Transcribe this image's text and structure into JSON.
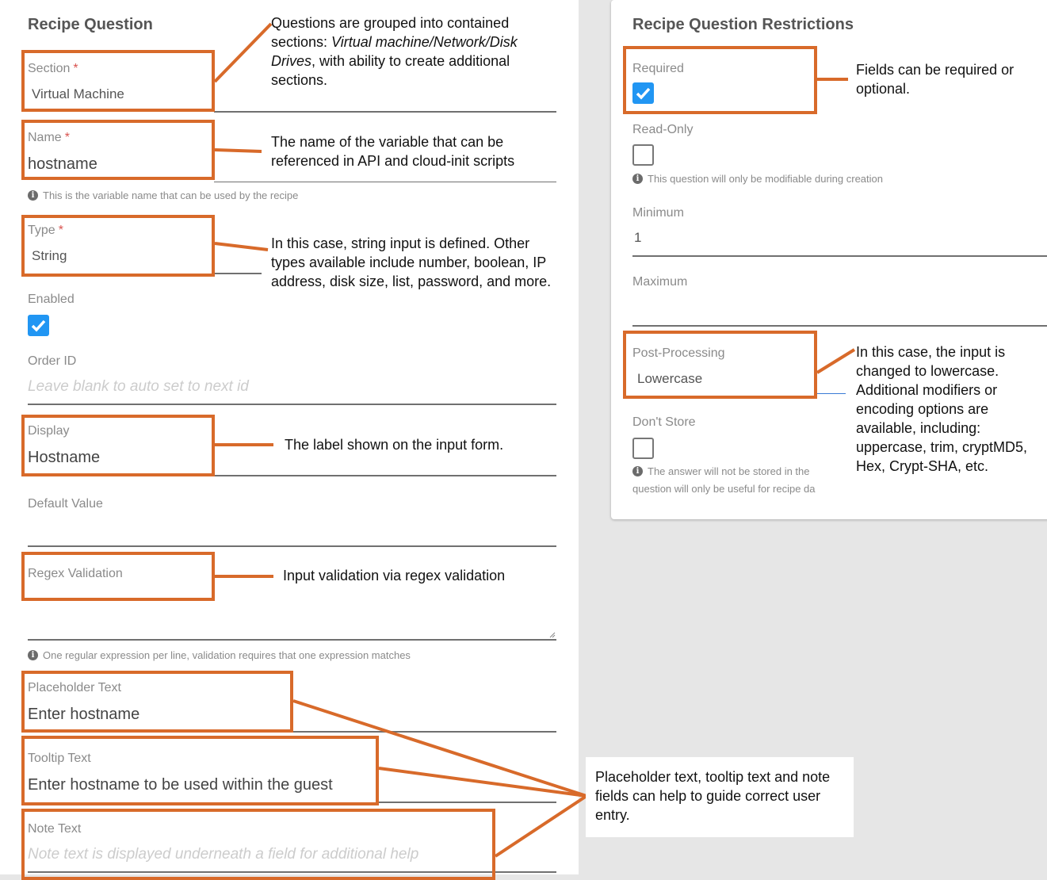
{
  "left": {
    "heading": "Recipe Question",
    "section": {
      "label": "Section",
      "required": "*",
      "value": "Virtual Machine"
    },
    "name": {
      "label": "Name",
      "required": "*",
      "value": "hostname",
      "hint": "This is the variable name that can be used by the recipe"
    },
    "type": {
      "label": "Type",
      "required": "*",
      "value": "String"
    },
    "enabled": {
      "label": "Enabled",
      "checked": true
    },
    "order_id": {
      "label": "Order ID",
      "placeholder": "Leave blank to auto set to next id"
    },
    "display": {
      "label": "Display",
      "value": "Hostname"
    },
    "default_value": {
      "label": "Default Value",
      "value": ""
    },
    "regex": {
      "label": "Regex Validation",
      "hint": "One regular expression per line, validation requires that one expression matches"
    },
    "placeholder_text": {
      "label": "Placeholder Text",
      "value": "Enter hostname"
    },
    "tooltip_text": {
      "label": "Tooltip Text",
      "value": "Enter hostname to be used within the guest"
    },
    "note_text": {
      "label": "Note Text",
      "placeholder": "Note text is displayed underneath a field for additional help"
    }
  },
  "right": {
    "heading": "Recipe Question Restrictions",
    "required": {
      "label": "Required",
      "checked": true
    },
    "read_only": {
      "label": "Read-Only",
      "checked": false,
      "hint": "This question will only be modifiable during creation"
    },
    "minimum": {
      "label": "Minimum",
      "value": "1"
    },
    "maximum": {
      "label": "Maximum",
      "value": ""
    },
    "post_processing": {
      "label": "Post-Processing",
      "value": "Lowercase"
    },
    "dont_store": {
      "label": "Don't Store",
      "checked": false,
      "hint_line1": "The answer will not be stored in the",
      "hint_line2": "question will only be useful for recipe da"
    }
  },
  "annotations": {
    "section_pre": "Questions are grouped into contained sections: ",
    "section_italic": "Virtual machine/Network/Disk Drives",
    "section_post": ", with ability to create additional sections.",
    "name": "The name of the variable that can be referenced in API and cloud-init scripts",
    "type": "In this case, string input is defined. Other types available include number, boolean, IP address, disk size, list, password, and more.",
    "display": "The label shown on the input form.",
    "regex": "Input validation via regex validation",
    "required": "Fields can be required or optional.",
    "post_processing": "In this case, the input is changed to lowercase. Additional modifiers or encoding options are available, including: uppercase, trim, cryptMD5,  Hex, Crypt-SHA, etc.",
    "guide": "Placeholder text, tooltip text and note fields can help to guide correct user entry."
  },
  "colors": {
    "annotation": "#d86a2a",
    "checkbox_checked": "#2196f3",
    "required_star": "#d9534f"
  },
  "icons": [
    "info-icon",
    "checkmark-icon",
    "resize-grip-icon"
  ]
}
